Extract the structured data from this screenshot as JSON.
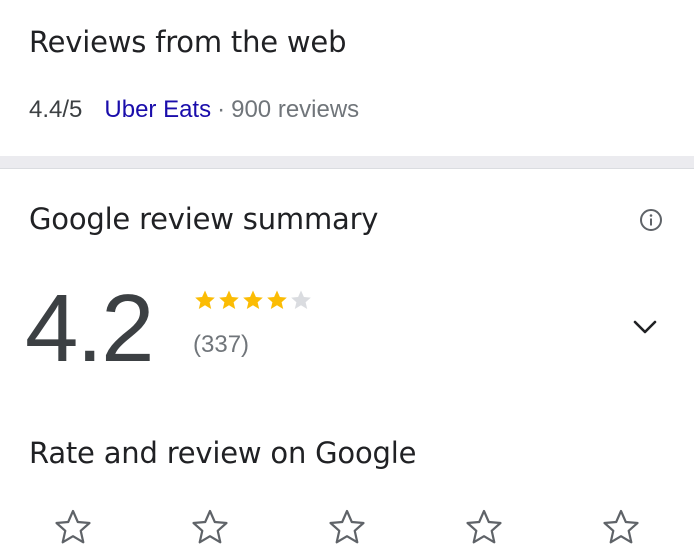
{
  "web_reviews": {
    "title": "Reviews from the web",
    "score": "4.4/5",
    "source": "Uber Eats",
    "separator": "·",
    "count": "900 reviews"
  },
  "summary": {
    "title": "Google review summary",
    "rating": "4.2",
    "stars": 4.2,
    "max_stars": 5,
    "count": "(337)",
    "info_icon": "info-icon",
    "expand_icon": "chevron-down-icon",
    "star_color": "#fbbc04",
    "empty_star_color": "#dadce0"
  },
  "rate": {
    "title": "Rate and review on Google",
    "star_count": 5,
    "star_icon": "star-outline-icon"
  },
  "colors": {
    "link": "#1a0dab",
    "muted": "#70757a",
    "divider": "#ebebef"
  }
}
